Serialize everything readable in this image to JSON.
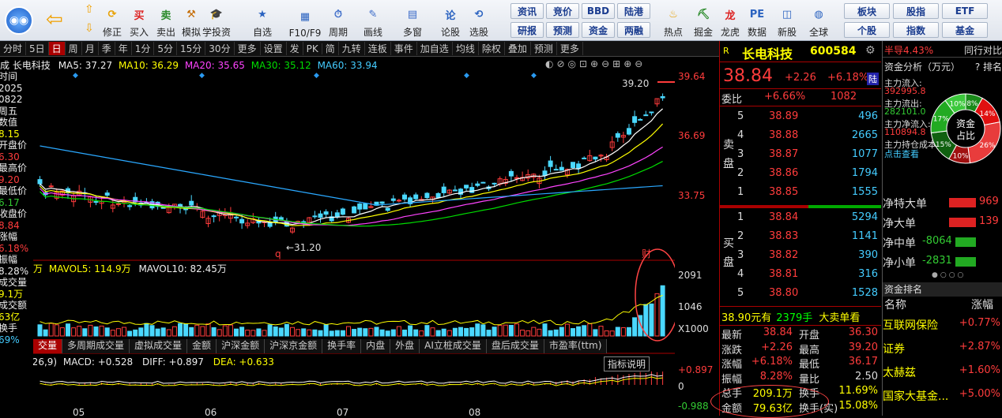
{
  "toolbar": {
    "buttons": [
      "修正",
      "买入",
      "卖出",
      "模拟",
      "学投资",
      "自选",
      "F10/F9",
      "周期",
      "画线",
      "多窗",
      "论股",
      "选股",
      "热点",
      "掘金",
      "龙虎",
      "数据",
      "新股",
      "全球"
    ],
    "grid": [
      [
        "资讯",
        "竞价",
        "BBD",
        "陆港"
      ],
      [
        "研报",
        "预测",
        "资金",
        "两融"
      ]
    ],
    "grid2": [
      [
        "板块",
        "股指",
        "ETF"
      ],
      [
        "个股",
        "指数",
        "基金"
      ]
    ]
  },
  "tabs": [
    "分时",
    "5日",
    "日",
    "周",
    "月",
    "季",
    "年",
    "1分",
    "5分",
    "15分",
    "30分",
    "更多",
    "设置",
    "发",
    "PK",
    "简",
    "九转",
    "连板",
    "事件",
    "加自选",
    "均线",
    "除权",
    "叠加",
    "预测",
    "更多"
  ],
  "tab_active": "日",
  "stock_title": "长电科技",
  "ma_line": {
    "prefix": "成",
    "name": "长电科技",
    "ma5": "MA5: 37.27",
    "ma10": "MA10: 36.29",
    "ma20": "MA20: 35.65",
    "ma30": "MA30: 35.12",
    "ma60": "MA60: 33.94"
  },
  "left_panel": [
    "时间",
    "2025",
    "0822",
    "周五",
    "数值",
    "8.15",
    "开盘价",
    "6.30",
    "最高价",
    "9.20",
    "最低价",
    "6.17",
    "收盘价",
    "8.84",
    "涨幅",
    "6.18%",
    "振幅",
    "8.28%",
    "成交量",
    "9.1万",
    "成交额",
    "63亿",
    "换手",
    "69%"
  ],
  "price_axis": [
    "39.64",
    "36.69",
    "33.75"
  ],
  "high_label": "39.20",
  "low_label": "31.20",
  "cai_label": "财",
  "vol_line": {
    "unit": "万",
    "mavol5": "MAVOL5: 114.9万",
    "mavol10": "MAVOL10: 82.45万"
  },
  "vol_axis": [
    "2091",
    "1046",
    "X1000"
  ],
  "bottom_tabs": [
    "交量",
    "多周期成交量",
    "虚拟成交量",
    "金额",
    "沪深金额",
    "沪深京金额",
    "换手率",
    "内盘",
    "外盘",
    "AI立桩成交量",
    "盘后成交量",
    "市盈率(ttm)"
  ],
  "macd_line": {
    "params": "(26,9)",
    "macd": "MACD: +0.528",
    "diff": "DIFF: +0.897",
    "dea": "DEA: +0.633",
    "help": "指标说明"
  },
  "macd_axis": [
    "+0.897",
    "0",
    "-0.988"
  ],
  "months": [
    "05",
    "06",
    "07",
    "08"
  ],
  "quote": {
    "code_prefix": "R",
    "name": "长电科技",
    "code": "600584",
    "price": "38.84",
    "change": "+2.26",
    "pct": "+6.18%",
    "tag": "陆",
    "weibi_label": "委比",
    "weibi": "+6.66%",
    "weicha": "1082",
    "sell_label": "卖盘",
    "buy_label": "买盘",
    "sells": [
      [
        "5",
        "38.89",
        "496"
      ],
      [
        "4",
        "38.88",
        "2665"
      ],
      [
        "3",
        "38.87",
        "1077"
      ],
      [
        "2",
        "38.86",
        "1794"
      ],
      [
        "1",
        "38.85",
        "1555"
      ]
    ],
    "buys": [
      [
        "1",
        "38.84",
        "5294"
      ],
      [
        "2",
        "38.83",
        "1141"
      ],
      [
        "3",
        "38.82",
        "390"
      ],
      [
        "4",
        "38.81",
        "316"
      ],
      [
        "5",
        "38.80",
        "1528"
      ]
    ],
    "big_order": [
      "38.90元有",
      "2379手",
      "大卖单看"
    ],
    "stats": [
      [
        "最新",
        "38.84",
        "开盘",
        "36.30"
      ],
      [
        "涨跌",
        "+2.26",
        "最高",
        "39.20"
      ],
      [
        "涨幅",
        "+6.18%",
        "最低",
        "36.17"
      ],
      [
        "振幅",
        "8.28%",
        "量比",
        "2.50"
      ],
      [
        "总手",
        "209.1万",
        "换手",
        "11.69%"
      ],
      [
        "金额",
        "79.63亿",
        "换手(实)",
        "15.08%"
      ]
    ]
  },
  "fund": {
    "header_pct": "半导4.43%",
    "header_right": "同行对比",
    "title": "资金分析（万元）",
    "rank": "? 排名",
    "inflow_label": "主力流入:",
    "inflow": "392995.8",
    "outflow_label": "主力流出:",
    "outflow": "282101.0",
    "net_label": "主力净流入:",
    "net": "110894.8",
    "hold_label": "主力持仓成本",
    "link": "点击查看",
    "donut_center": "资金占比",
    "donut": [
      {
        "label": "8%",
        "value": 8,
        "color": "#1a8a1a"
      },
      {
        "label": "14%",
        "value": 14,
        "color": "#e01010"
      },
      {
        "label": "26%",
        "value": 26,
        "color": "#e83c3c"
      },
      {
        "label": "10%",
        "value": 10,
        "color": "#a01010"
      },
      {
        "label": "15%",
        "value": 15,
        "color": "#106010"
      },
      {
        "label": "17%",
        "value": 17,
        "color": "#22aa22"
      },
      {
        "label": "10%",
        "value": 10,
        "color": "#3cc83c"
      }
    ],
    "flows": [
      {
        "label": "净特大单",
        "value": "969",
        "color": "#d22"
      },
      {
        "label": "净大单",
        "value": "139",
        "color": "#d22"
      },
      {
        "label": "净中单",
        "value": "-8064",
        "color": "#2a2"
      },
      {
        "label": "净小单",
        "value": "-2831",
        "color": "#2a2"
      }
    ],
    "sector_title": "资金排名",
    "col_name": "名称",
    "col_pct": "涨幅",
    "sectors": [
      [
        "互联网保险",
        "+0.77%"
      ],
      [
        "证券",
        "+2.87%"
      ],
      [
        "太赫兹",
        "+1.60%"
      ],
      [
        "国家大基金...",
        "+5.00%"
      ]
    ]
  }
}
